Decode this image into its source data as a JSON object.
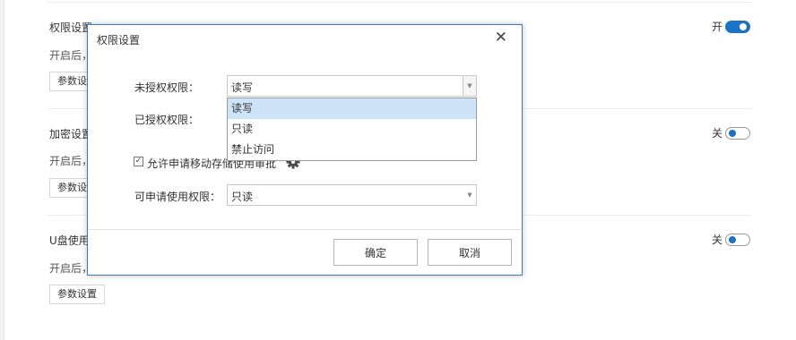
{
  "sections": [
    {
      "title": "权限设置",
      "desc": "开启后，",
      "param_button": "参数设置",
      "toggle_label": "开",
      "toggle_on": true
    },
    {
      "title": "加密设置",
      "desc": "开启后，",
      "param_button": "参数设置",
      "toggle_label": "关",
      "toggle_on": false
    },
    {
      "title": "U盘使用",
      "desc": "开启后，",
      "param_button": "参数设置",
      "toggle_label": "关",
      "toggle_on": false
    }
  ],
  "dialog": {
    "title": "权限设置",
    "unauthorized_label": "未授权权限：",
    "unauthorized_value": "读写",
    "authorized_label": "已授权权限：",
    "dropdown_options": [
      "读写",
      "只读",
      "禁止访问"
    ],
    "dropdown_selected_index": 0,
    "checkbox_checked": true,
    "checkbox_label": "允许申请移动存储使用审批",
    "apply_label": "可申请使用权限：",
    "apply_value": "只读",
    "ok_button": "确定",
    "cancel_button": "取消"
  },
  "colors": {
    "accent": "#1a73c7",
    "dialog_border": "#3b7dc4",
    "option_highlight": "#cde3f7"
  }
}
